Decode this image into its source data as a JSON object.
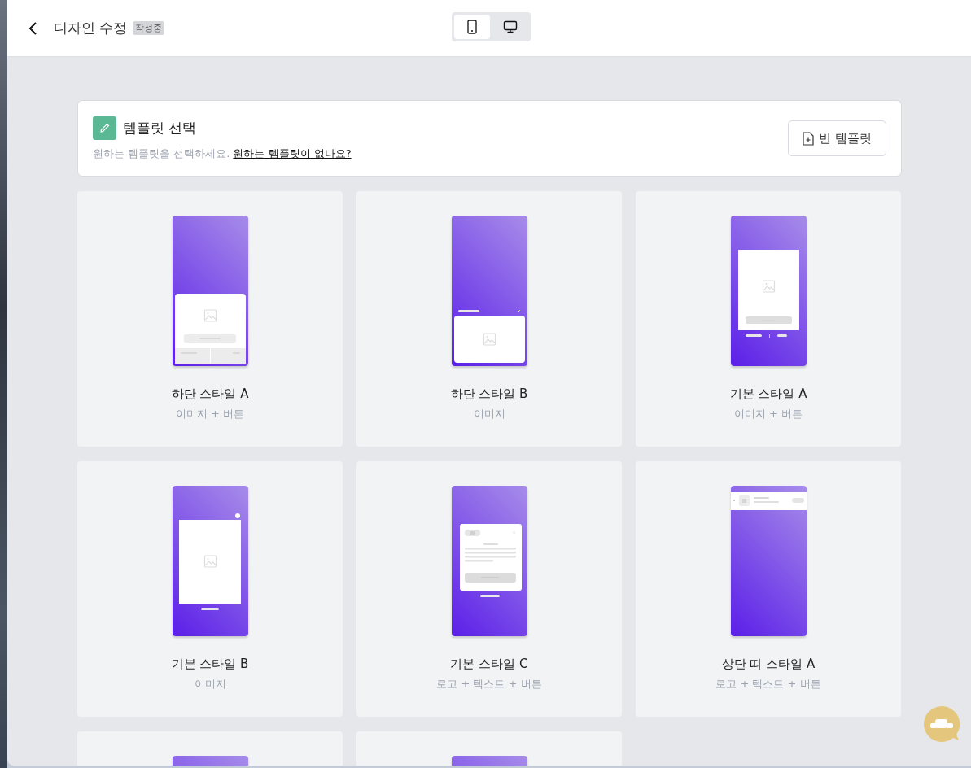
{
  "header": {
    "title": "디자인 수정",
    "badge": "작성중",
    "devices": [
      {
        "kind": "mobile",
        "selected": true
      },
      {
        "kind": "desktop",
        "selected": false
      }
    ]
  },
  "intro": {
    "title": "템플릿 선택",
    "description": "원하는 템플릿을 선택하세요.",
    "link": "원하는 템플릿이 없나요?",
    "button": "빈 템플릿"
  },
  "templates": [
    {
      "kind": "bottom-a",
      "name": "하단 스타일 A",
      "subtitle": "이미지 + 버튼"
    },
    {
      "kind": "bottom-b",
      "name": "하단 스타일 B",
      "subtitle": "이미지"
    },
    {
      "kind": "basic-a",
      "name": "기본 스타일 A",
      "subtitle": "이미지 + 버튼"
    },
    {
      "kind": "basic-b",
      "name": "기본 스타일 B",
      "subtitle": "이미지"
    },
    {
      "kind": "basic-c",
      "name": "기본 스타일 C",
      "subtitle": "로고 + 텍스트 + 버튼"
    },
    {
      "kind": "top-a",
      "name": "상단 띠 스타일 A",
      "subtitle": "로고 + 텍스트 + 버튼"
    },
    {
      "kind": "cut"
    },
    {
      "kind": "cut"
    }
  ]
}
